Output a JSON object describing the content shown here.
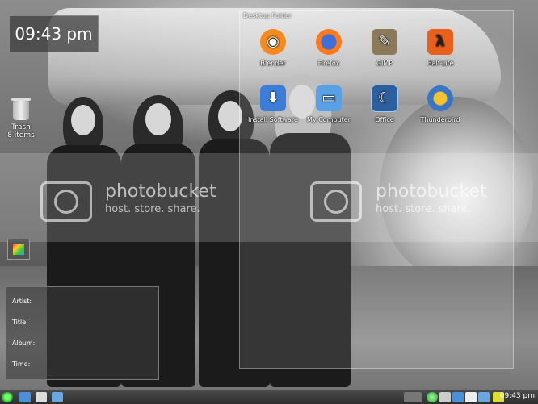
{
  "clock": {
    "time": "09:43 pm"
  },
  "trash": {
    "label": "Trash",
    "count": "8 items"
  },
  "folder_view": {
    "title": "Desktop Folder",
    "icons": [
      {
        "label": "Blender",
        "icon": "blender-icon",
        "color": "#f58a1f"
      },
      {
        "label": "Firefox",
        "icon": "firefox-icon",
        "color": "#ff7a1a"
      },
      {
        "label": "GIMP",
        "icon": "gimp-icon",
        "color": "#8a7a5a"
      },
      {
        "label": "Half-Life",
        "icon": "half-life-icon",
        "color": "#e8601c"
      },
      {
        "label": "Install Software",
        "icon": "install-software-icon",
        "color": "#3b7dd8"
      },
      {
        "label": "My Computer",
        "icon": "computer-icon",
        "color": "#5aa0e6"
      },
      {
        "label": "Office",
        "icon": "office-icon",
        "color": "#2b5f9e"
      },
      {
        "label": "Thunderbird",
        "icon": "thunderbird-icon",
        "color": "#3a75c4"
      }
    ]
  },
  "watermark": {
    "brand": "photobucket",
    "tagline": "host. store. share."
  },
  "now_playing": {
    "artist_label": "Artist:",
    "title_label": "Title:",
    "album_label": "Album:",
    "time_label": "Time:"
  },
  "taskbar": {
    "clock": "09:43 pm"
  }
}
